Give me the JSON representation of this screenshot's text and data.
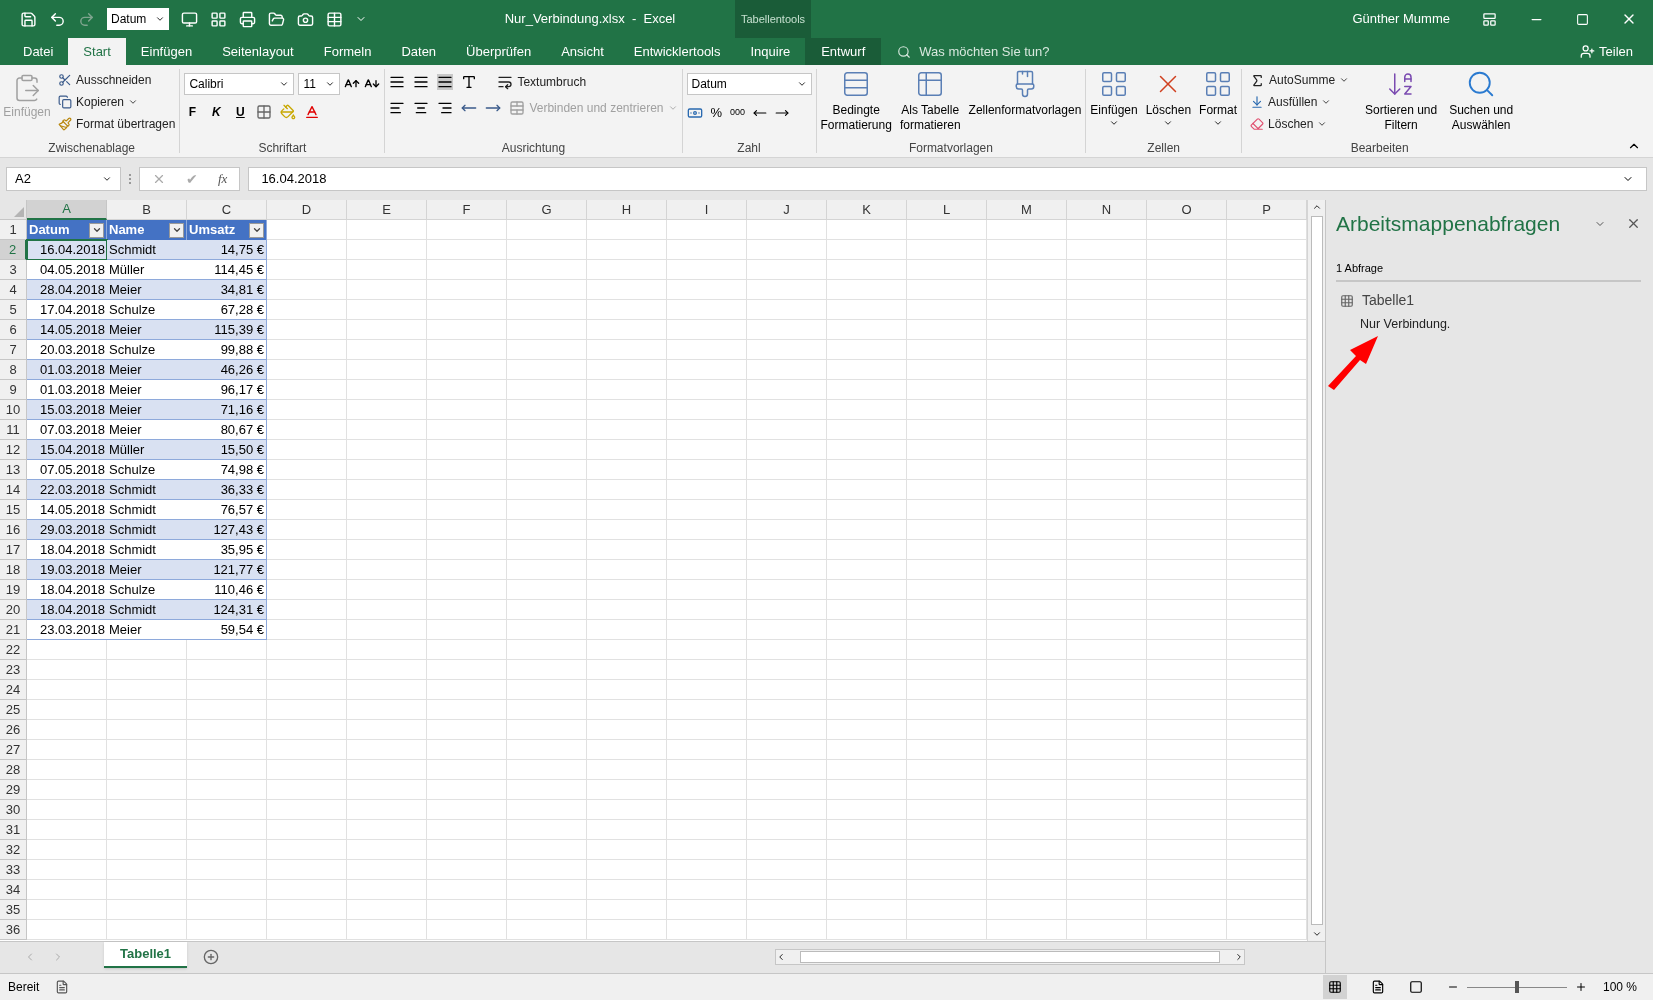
{
  "title_bar": {
    "format_box": "Datum",
    "file_title": "Nur_Verbindung.xlsx  -  Excel",
    "contextual_label": "Tabellentools",
    "user": "Günther Mumme"
  },
  "tabs": [
    {
      "label": "Datei",
      "selected": false,
      "kind": "file"
    },
    {
      "label": "Start",
      "selected": true,
      "kind": "normal"
    },
    {
      "label": "Einfügen",
      "selected": false,
      "kind": "normal"
    },
    {
      "label": "Seitenlayout",
      "selected": false,
      "kind": "normal"
    },
    {
      "label": "Formeln",
      "selected": false,
      "kind": "normal"
    },
    {
      "label": "Daten",
      "selected": false,
      "kind": "normal"
    },
    {
      "label": "Überprüfen",
      "selected": false,
      "kind": "normal"
    },
    {
      "label": "Ansicht",
      "selected": false,
      "kind": "normal"
    },
    {
      "label": "Entwicklertools",
      "selected": false,
      "kind": "normal"
    },
    {
      "label": "Inquire",
      "selected": false,
      "kind": "normal"
    },
    {
      "label": "Entwurf",
      "selected": false,
      "kind": "contextual"
    }
  ],
  "tell_me": {
    "placeholder": "Was möchten Sie tun?"
  },
  "share": "Teilen",
  "ribbon": {
    "clipboard": {
      "paste": {
        "label": "Einfügen",
        "disabled": true
      },
      "cut": "Ausschneiden",
      "copy": "Kopieren",
      "format_painter": "Format übertragen",
      "group": "Zwischenablage"
    },
    "font": {
      "name": "Calibri",
      "size": "11",
      "bold": "F",
      "italic": "K",
      "underline": "U",
      "group": "Schriftart"
    },
    "alignment": {
      "wrap": {
        "label": "Textumbruch",
        "disabled": false
      },
      "merge": {
        "label": "Verbinden und zentrieren",
        "disabled": true
      },
      "group": "Ausrichtung"
    },
    "number": {
      "format": "Datum",
      "percent": "%",
      "thousands": "000",
      "group": "Zahl"
    },
    "styles": {
      "commands": [
        "Bedingte\nFormatierung",
        "Als Tabelle\nformatieren",
        "Zellenformatvorlagen"
      ],
      "group": "Formatvorlagen"
    },
    "cells": {
      "commands": [
        "Einfügen",
        "Löschen",
        "Format"
      ],
      "group": "Zellen"
    },
    "editing": {
      "autosum": "AutoSumme",
      "fill": "Ausfüllen",
      "clear": "Löschen",
      "sort": "Sortieren und\nFiltern",
      "find": "Suchen und\nAuswählen",
      "group": "Bearbeiten"
    }
  },
  "formula_bar": {
    "name_box": "A2",
    "enter": "✔",
    "function": "fx",
    "formula": "16.04.2018"
  },
  "columns": [
    {
      "label": "A",
      "selected": true
    },
    {
      "label": "B",
      "selected": false
    },
    {
      "label": "C",
      "selected": false
    },
    {
      "label": "D",
      "selected": false
    },
    {
      "label": "E",
      "selected": false
    },
    {
      "label": "F",
      "selected": false
    },
    {
      "label": "G",
      "selected": false
    },
    {
      "label": "H",
      "selected": false
    },
    {
      "label": "I",
      "selected": false
    },
    {
      "label": "J",
      "selected": false
    },
    {
      "label": "K",
      "selected": false
    },
    {
      "label": "L",
      "selected": false
    },
    {
      "label": "M",
      "selected": false
    },
    {
      "label": "N",
      "selected": false
    },
    {
      "label": "O",
      "selected": false
    },
    {
      "label": "P",
      "selected": false
    }
  ],
  "table": {
    "headers": [
      "Datum",
      "Name",
      "Umsatz"
    ],
    "rows": [
      {
        "date": "16.04.2018",
        "name": "Schmidt",
        "amount": "14,75 €",
        "active": true
      },
      {
        "date": "04.05.2018",
        "name": "Müller",
        "amount": "114,45 €",
        "active": false
      },
      {
        "date": "28.04.2018",
        "name": "Meier",
        "amount": "34,81 €",
        "active": false
      },
      {
        "date": "17.04.2018",
        "name": "Schulze",
        "amount": "67,28 €",
        "active": false
      },
      {
        "date": "14.05.2018",
        "name": "Meier",
        "amount": "115,39 €",
        "active": false
      },
      {
        "date": "20.03.2018",
        "name": "Schulze",
        "amount": "99,88 €",
        "active": false
      },
      {
        "date": "01.03.2018",
        "name": "Meier",
        "amount": "46,26 €",
        "active": false
      },
      {
        "date": "01.03.2018",
        "name": "Meier",
        "amount": "96,17 €",
        "active": false
      },
      {
        "date": "15.03.2018",
        "name": "Meier",
        "amount": "71,16 €",
        "active": false
      },
      {
        "date": "07.03.2018",
        "name": "Meier",
        "amount": "80,67 €",
        "active": false
      },
      {
        "date": "15.04.2018",
        "name": "Müller",
        "amount": "15,50 €",
        "active": false
      },
      {
        "date": "07.05.2018",
        "name": "Schulze",
        "amount": "74,98 €",
        "active": false
      },
      {
        "date": "22.03.2018",
        "name": "Schmidt",
        "amount": "36,33 €",
        "active": false
      },
      {
        "date": "14.05.2018",
        "name": "Schmidt",
        "amount": "76,57 €",
        "active": false
      },
      {
        "date": "29.03.2018",
        "name": "Schmidt",
        "amount": "127,43 €",
        "active": false
      },
      {
        "date": "18.04.2018",
        "name": "Schmidt",
        "amount": "35,95 €",
        "active": false
      },
      {
        "date": "19.03.2018",
        "name": "Meier",
        "amount": "121,77 €",
        "active": false
      },
      {
        "date": "18.04.2018",
        "name": "Schulze",
        "amount": "110,46 €",
        "active": false
      },
      {
        "date": "18.04.2018",
        "name": "Schmidt",
        "amount": "124,31 €",
        "active": false
      },
      {
        "date": "23.03.2018",
        "name": "Meier",
        "amount": "59,54 €",
        "active": false
      }
    ]
  },
  "row_headers": [
    {
      "label": "1",
      "selected": false
    },
    {
      "label": "2",
      "selected": true
    },
    {
      "label": "3",
      "selected": false
    },
    {
      "label": "4",
      "selected": false
    },
    {
      "label": "5",
      "selected": false
    },
    {
      "label": "6",
      "selected": false
    },
    {
      "label": "7",
      "selected": false
    },
    {
      "label": "8",
      "selected": false
    },
    {
      "label": "9",
      "selected": false
    },
    {
      "label": "10",
      "selected": false
    },
    {
      "label": "11",
      "selected": false
    },
    {
      "label": "12",
      "selected": false
    },
    {
      "label": "13",
      "selected": false
    },
    {
      "label": "14",
      "selected": false
    },
    {
      "label": "15",
      "selected": false
    },
    {
      "label": "16",
      "selected": false
    },
    {
      "label": "17",
      "selected": false
    },
    {
      "label": "18",
      "selected": false
    },
    {
      "label": "19",
      "selected": false
    },
    {
      "label": "20",
      "selected": false
    },
    {
      "label": "21",
      "selected": false
    },
    {
      "label": "22",
      "selected": false
    },
    {
      "label": "23",
      "selected": false
    },
    {
      "label": "24",
      "selected": false
    },
    {
      "label": "25",
      "selected": false
    },
    {
      "label": "26",
      "selected": false
    },
    {
      "label": "27",
      "selected": false
    },
    {
      "label": "28",
      "selected": false
    },
    {
      "label": "29",
      "selected": false
    },
    {
      "label": "30",
      "selected": false
    },
    {
      "label": "31",
      "selected": false
    },
    {
      "label": "32",
      "selected": false
    },
    {
      "label": "33",
      "selected": false
    },
    {
      "label": "34",
      "selected": false
    },
    {
      "label": "35",
      "selected": false
    },
    {
      "label": "36",
      "selected": false
    }
  ],
  "queries_pane": {
    "title": "Arbeitsmappenabfragen",
    "count": "1 Abfrage",
    "queries": [
      {
        "name": "Tabelle1",
        "status": "Nur Verbindung."
      }
    ]
  },
  "sheet_tabs": [
    {
      "label": "Tabelle1",
      "selected": true
    }
  ],
  "status_bar": {
    "status": "Bereit",
    "zoom": "100 %",
    "zoom_slider": {
      "level": 0.5
    }
  }
}
